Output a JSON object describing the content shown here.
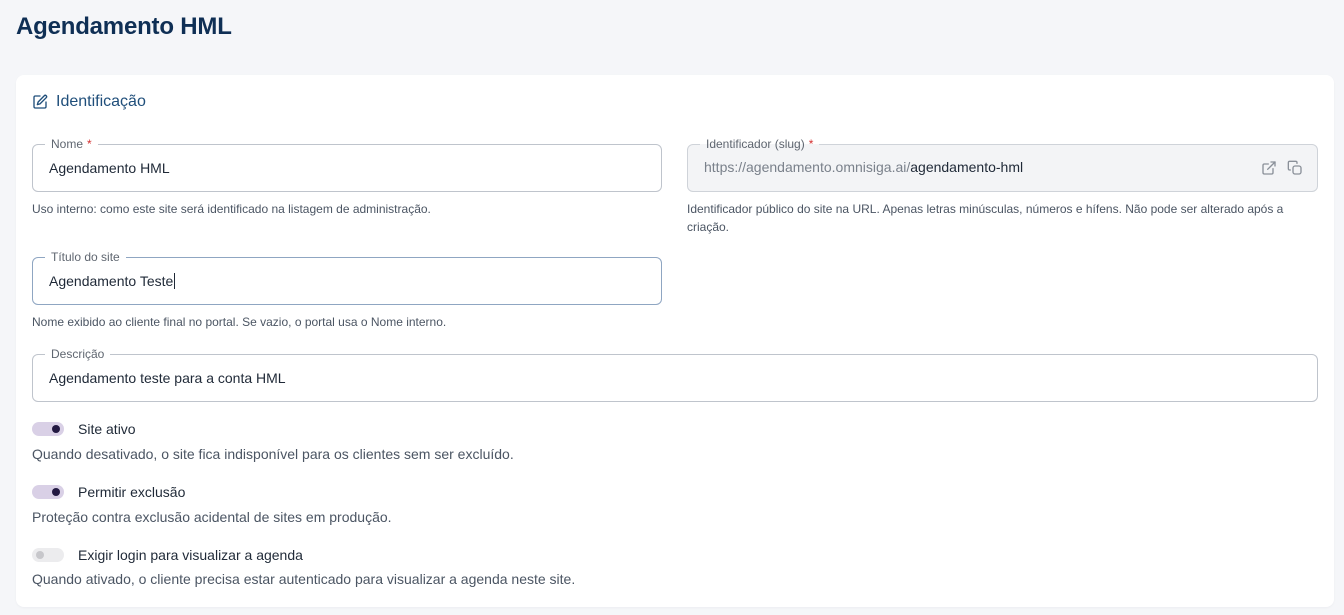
{
  "page": {
    "title": "Agendamento HML"
  },
  "section": {
    "title": "Identificação",
    "icon": "edit-icon"
  },
  "fields": {
    "nome": {
      "label": "Nome",
      "required_mark": "*",
      "value": "Agendamento HML",
      "helper": "Uso interno: como este site será identificado na listagem de administração."
    },
    "slug": {
      "label": "Identificador (slug)",
      "required_mark": "*",
      "prefix": "https://agendamento.omnisiga.ai/",
      "value": "agendamento-hml",
      "helper_line1": "Identificador público do site na URL. Apenas letras minúsculas, números e hífens. Não pode ser alterado após a",
      "helper_line2": "criação.",
      "icons": [
        "external-link-icon",
        "copy-icon"
      ]
    },
    "titulo": {
      "label": "Título do site",
      "value": "Agendamento Teste",
      "helper": "Nome exibido ao cliente final no portal. Se vazio, o portal usa o Nome interno."
    },
    "descricao": {
      "label": "Descrição",
      "value": "Agendamento teste para a conta HML"
    }
  },
  "toggles": [
    {
      "label": "Site ativo",
      "on": true,
      "description": "Quando desativado, o site fica indisponível para os clientes sem ser excluído."
    },
    {
      "label": "Permitir exclusão",
      "on": true,
      "description": "Proteção contra exclusão acidental de sites em produção."
    },
    {
      "label": "Exigir login para visualizar a agenda",
      "on": false,
      "description": "Quando ativado, o cliente precisa estar autenticado para visualizar a agenda neste site."
    }
  ],
  "colors": {
    "title": "#0f2f55",
    "accent": "#1f4e7a",
    "required": "#d32f2f",
    "toggle_on_track": "#d9d0e6",
    "toggle_on_knob": "#231942"
  }
}
